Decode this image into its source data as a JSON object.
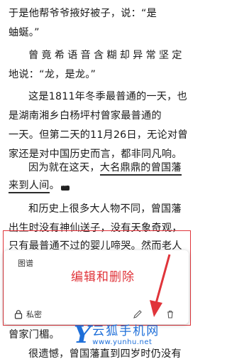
{
  "reader": {
    "lines": [
      "于是他帮爷爷掖好被子，说：“是",
      "蚰蜒。”",
      "曾竟希语音含糊却异常坚定",
      "地说：“龙，是龙。”",
      "这是1811年冬季最普通的一天，也",
      "是湖南湘乡白杨坪村曾家最普通的",
      "一天。但第二天的11月26日，无论对曾",
      "家还是对中国历史而言，都非同凡响。",
      "因为就在这天，",
      "大名鼎鼎的曾国藩",
      "来到人间",
      "。",
      "和历史上很多大人物不同，曾国藩",
      "出生时没有神仙送子，没有天象奇观，",
      "只有最普通不过的婴儿啼哭。然而老人",
      "曾家门楣。",
      "很遗憾，曾国藩直到四岁时仍没有"
    ]
  },
  "note_popup": {
    "header": "图谱",
    "private_label": "私密"
  },
  "annotation": {
    "text": "编辑和删除",
    "color": "#e0343a"
  },
  "watermark": {
    "logo_letter": "Y",
    "name": "云狐手机网",
    "url": "www.yunhu.net",
    "color": "#1e6fd9"
  },
  "icons": {
    "lock": "lock-icon",
    "edit": "edit-icon",
    "delete": "delete-icon",
    "note_marker": "note-marker-icon"
  }
}
